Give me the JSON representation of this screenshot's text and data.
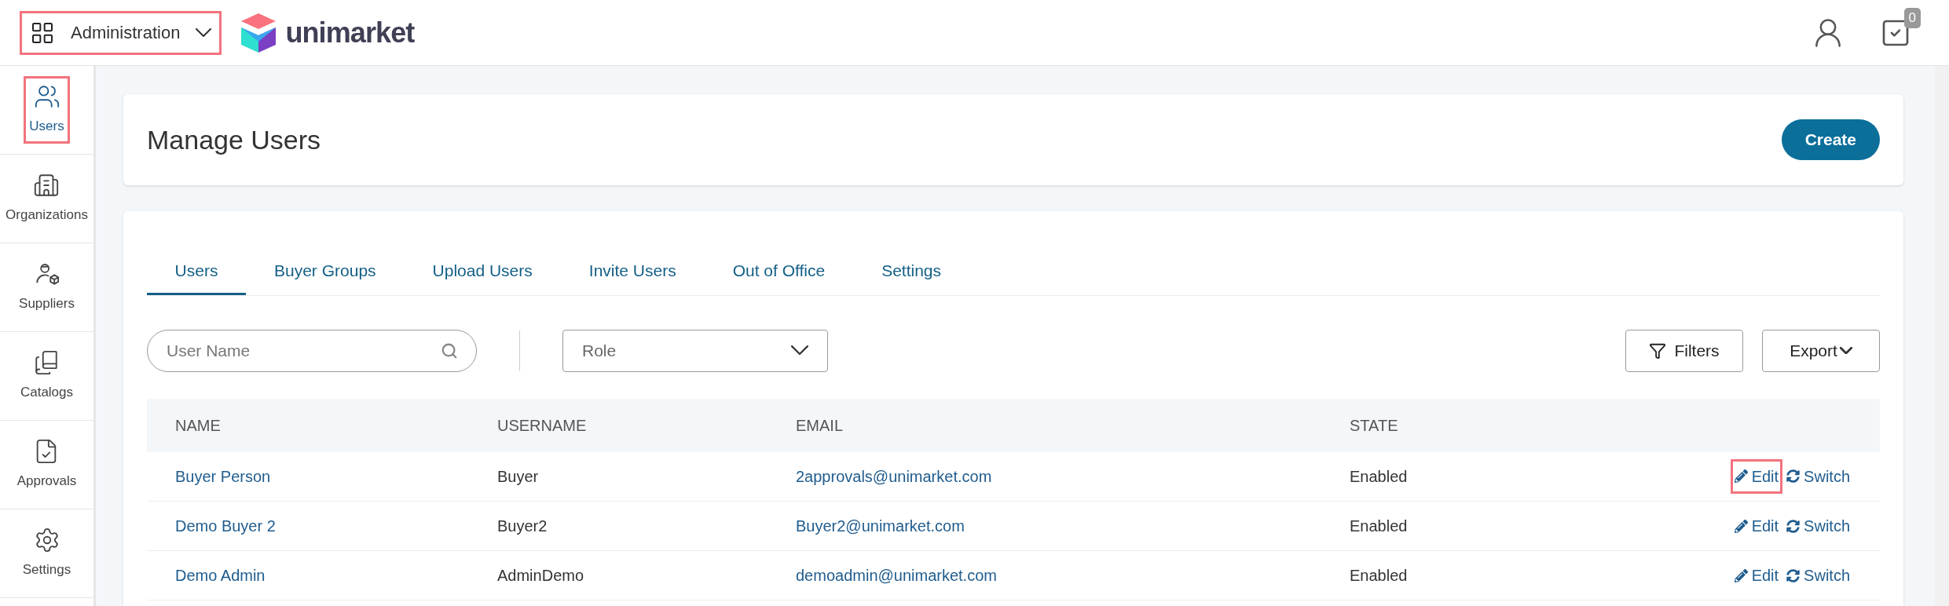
{
  "header": {
    "app_switcher": {
      "label": "Administration",
      "highlighted": true
    },
    "brand": "unimarket",
    "notification_badge": "0"
  },
  "sidebar": {
    "items": [
      {
        "label": "Users",
        "kind": "users",
        "selected": true,
        "highlighted": true
      },
      {
        "label": "Organizations",
        "kind": "organizations",
        "selected": false,
        "highlighted": false
      },
      {
        "label": "Suppliers",
        "kind": "suppliers",
        "selected": false,
        "highlighted": false
      },
      {
        "label": "Catalogs",
        "kind": "catalogs",
        "selected": false,
        "highlighted": false
      },
      {
        "label": "Approvals",
        "kind": "approvals",
        "selected": false,
        "highlighted": false
      },
      {
        "label": "Settings",
        "kind": "settings",
        "selected": false,
        "highlighted": false
      }
    ]
  },
  "page_title": "Manage Users",
  "create_button": "Create",
  "tabs": [
    {
      "label": "Users",
      "selected": true
    },
    {
      "label": "Buyer Groups",
      "selected": false
    },
    {
      "label": "Upload Users",
      "selected": false
    },
    {
      "label": "Invite Users",
      "selected": false
    },
    {
      "label": "Out of Office",
      "selected": false
    },
    {
      "label": "Settings",
      "selected": false
    }
  ],
  "search": {
    "placeholder": "User Name"
  },
  "role_select": {
    "placeholder": "Role"
  },
  "filters_button": "Filters",
  "export_button": "Export",
  "table": {
    "columns": [
      "NAME",
      "USERNAME",
      "EMAIL",
      "STATE"
    ],
    "rows": [
      {
        "name": "Buyer Person",
        "username": "Buyer",
        "email": "2approvals@unimarket.com",
        "state": "Enabled",
        "actions": [
          {
            "kind": "edit",
            "label": "Edit",
            "highlighted": true
          },
          {
            "kind": "switch",
            "label": "Switch",
            "highlighted": false
          }
        ]
      },
      {
        "name": "Demo Buyer 2",
        "username": "Buyer2",
        "email": "Buyer2@unimarket.com",
        "state": "Enabled",
        "actions": [
          {
            "kind": "edit",
            "label": "Edit",
            "highlighted": false
          },
          {
            "kind": "switch",
            "label": "Switch",
            "highlighted": false
          }
        ]
      },
      {
        "name": "Demo Admin",
        "username": "AdminDemo",
        "email": "demoadmin@unimarket.com",
        "state": "Enabled",
        "actions": [
          {
            "kind": "edit",
            "label": "Edit",
            "highlighted": false
          },
          {
            "kind": "switch",
            "label": "Switch",
            "highlighted": false
          }
        ]
      }
    ]
  }
}
